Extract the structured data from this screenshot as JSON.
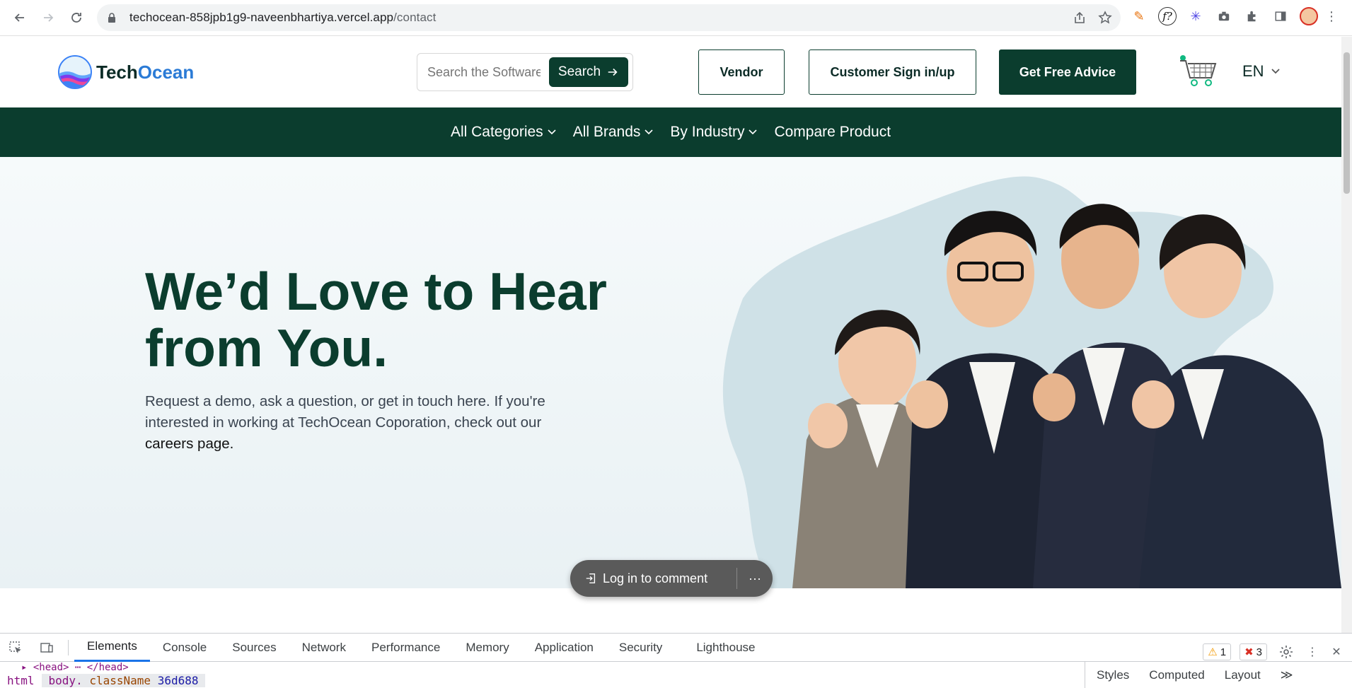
{
  "browser": {
    "url_host": "techocean-858jpb1g9-naveenbhartiya.vercel.app",
    "url_path": "/contact"
  },
  "header": {
    "logo_part1": "Tech",
    "logo_part2": "Ocean",
    "search_placeholder": "Search the Software",
    "search_button": "Search",
    "vendor_button": "Vendor",
    "customer_button": "Customer Sign in/up",
    "advice_button": "Get Free Advice",
    "language": "EN"
  },
  "nav": {
    "items": [
      "All Categories",
      "All Brands",
      "By Industry",
      "Compare Product"
    ]
  },
  "hero": {
    "title": "We’d Love to Hear from You.",
    "text_before_link": "Request a demo, ask a question, or get in touch here. If you're interested in working at TechOcean Coporation, check out our ",
    "link_text": "careers page."
  },
  "comment_widget": {
    "login_label": "Log in to comment",
    "more_label": "···"
  },
  "devtools": {
    "tabs": [
      "Elements",
      "Console",
      "Sources",
      "Network",
      "Performance",
      "Memory",
      "Application",
      "Security",
      "Lighthouse"
    ],
    "active_tab": "Elements",
    "warnings": "1",
    "errors": "3",
    "dom_line": "▸ <head> ⋯ </head>",
    "crumbs": {
      "html": "html",
      "body": "body.",
      "attr_name": "className",
      "attr_value": "36d688"
    },
    "side_tabs": [
      "Styles",
      "Computed",
      "Layout"
    ],
    "side_more": "≫"
  },
  "colors": {
    "brand_green": "#0b3d2e",
    "accent_blue": "#2b7bd6"
  }
}
